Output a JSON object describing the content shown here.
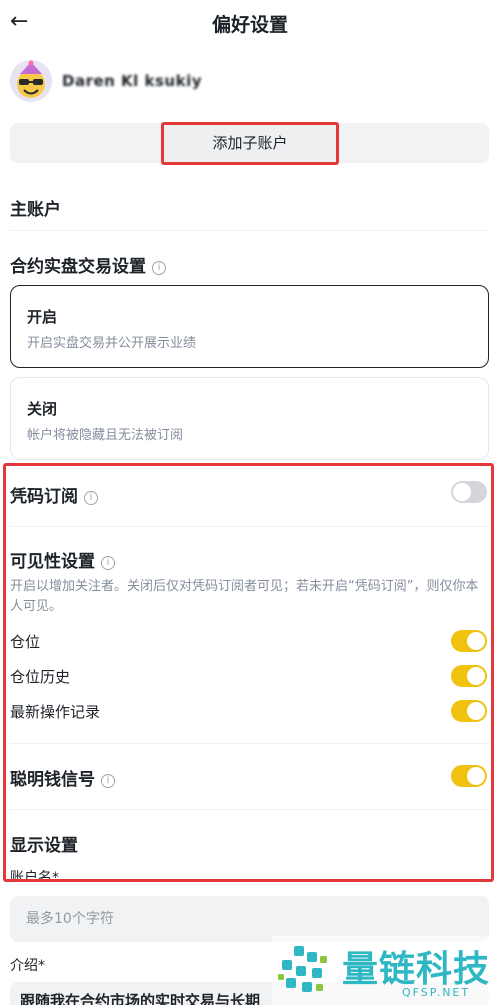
{
  "header": {
    "title": "偏好设置",
    "back_icon": "arrow-left-icon"
  },
  "account": {
    "username": "Daren Kl   ksukiy",
    "add_subaccount_label": "添加子账户"
  },
  "main_account": {
    "title": "主账户"
  },
  "contract_trading": {
    "title": "合约实盘交易设置",
    "options": [
      {
        "label": "开启",
        "description": "开启实盘交易并公开展示业绩",
        "selected": true
      },
      {
        "label": "关闭",
        "description": "帐户将被隐藏且无法被订阅",
        "selected": false
      }
    ]
  },
  "code_subscription": {
    "title": "凭码订阅",
    "enabled": false
  },
  "visibility": {
    "title": "可见性设置",
    "description": "开启以增加关注者。关闭后仅对凭码订阅者可见；若未开启“凭码订阅”，则仅你本人可见。",
    "items": [
      {
        "label": "仓位",
        "enabled": true
      },
      {
        "label": "仓位历史",
        "enabled": true
      },
      {
        "label": "最新操作记录",
        "enabled": true
      }
    ]
  },
  "smart_money": {
    "title": "聪明钱信号",
    "enabled": true
  },
  "display": {
    "title": "显示设置",
    "account_name_label": "账户名*",
    "account_name_placeholder": "最多10个字符",
    "intro_label": "介绍*",
    "intro_value": "跟随我在合约市场的实时交易与长期"
  },
  "watermark": {
    "name": "量链科技",
    "site": "QFSP.NET"
  },
  "colors": {
    "accent_yellow": "#f0c20e",
    "highlight_red": "#e5383b",
    "muted_text": "#848e9c"
  }
}
